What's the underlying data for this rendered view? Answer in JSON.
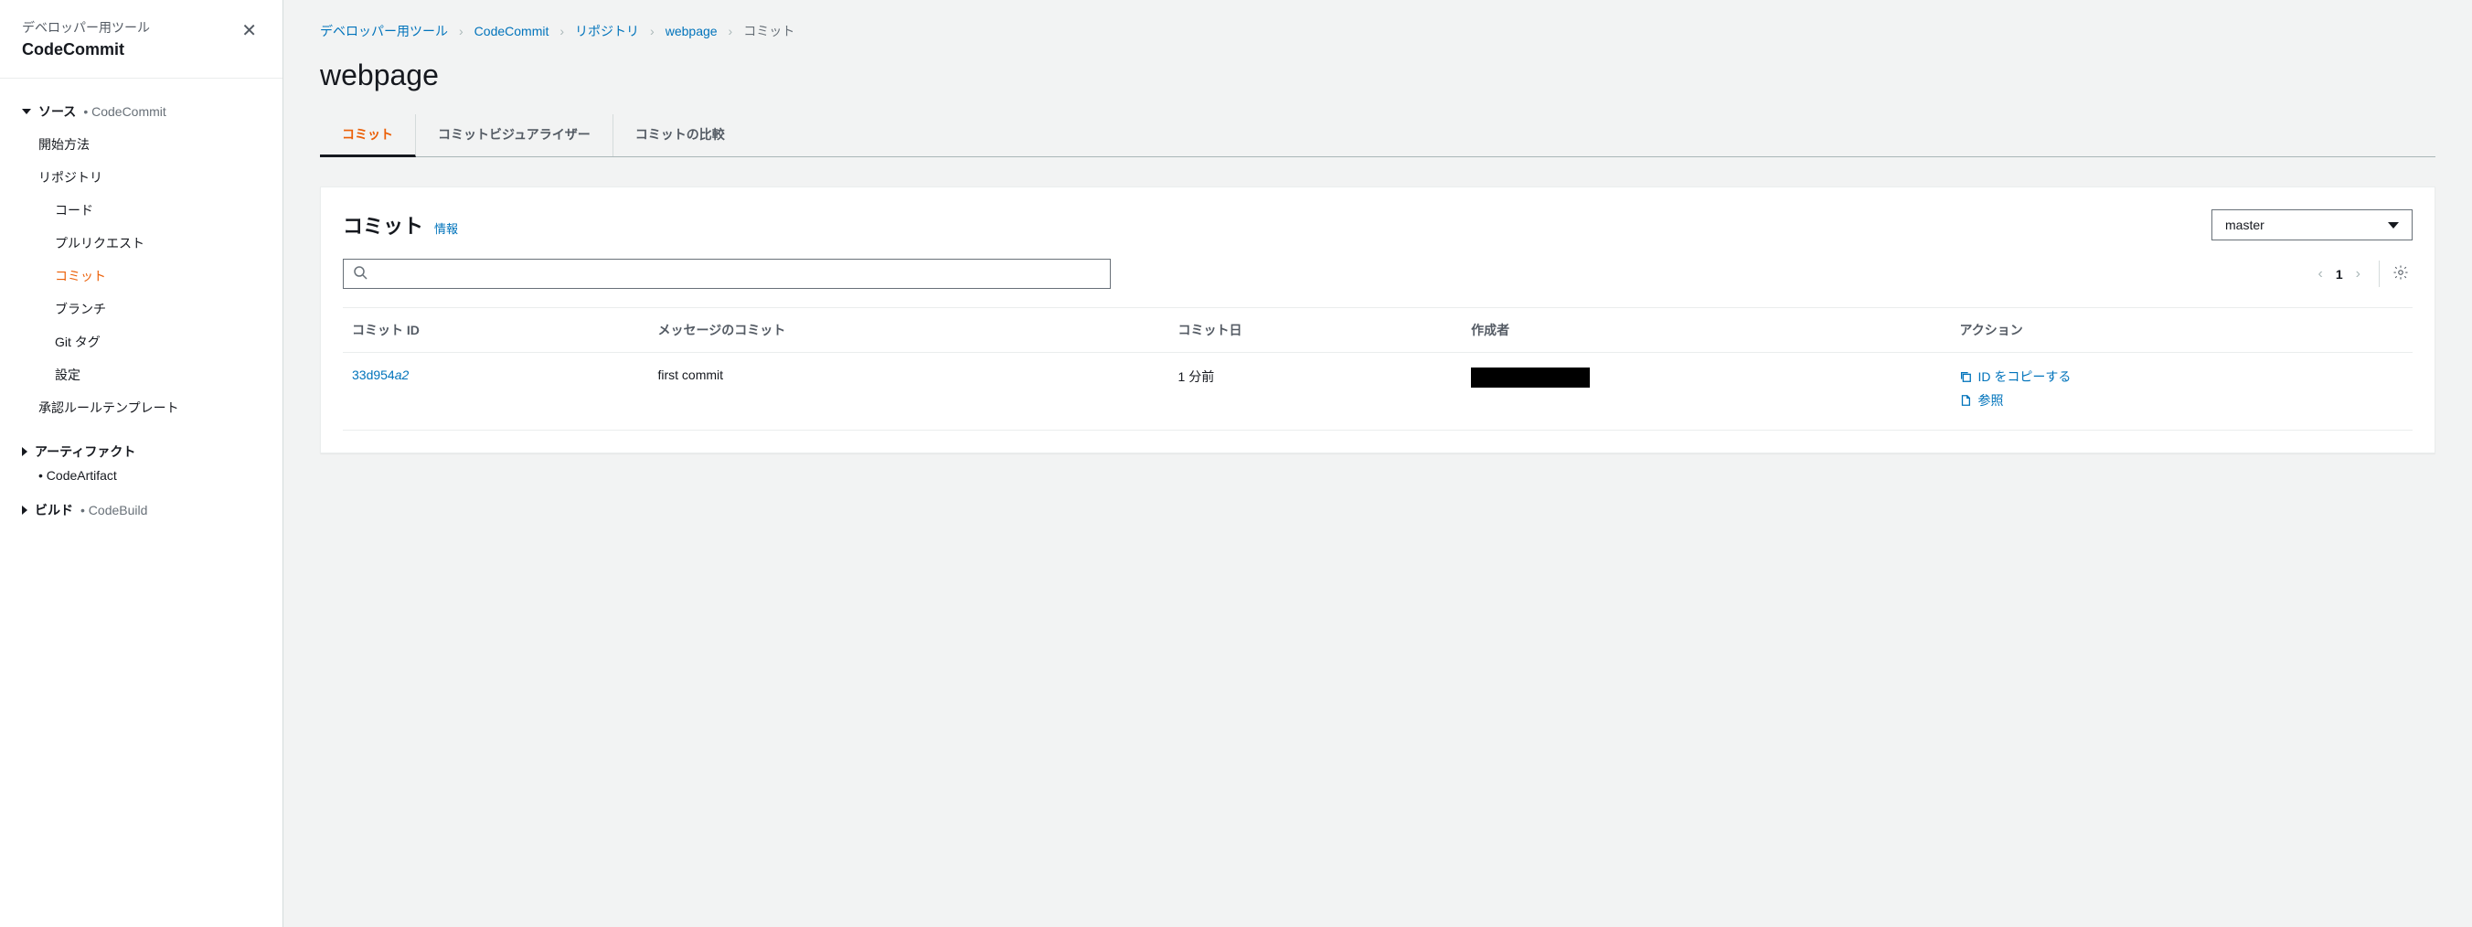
{
  "sidebar": {
    "subtitle": "デベロッパー用ツール",
    "title": "CodeCommit",
    "sections": [
      {
        "label": "ソース",
        "muted": "• CodeCommit",
        "expanded": true,
        "items": [
          {
            "label": "開始方法",
            "indent": false,
            "active": false
          },
          {
            "label": "リポジトリ",
            "indent": false,
            "active": false
          },
          {
            "label": "コード",
            "indent": true,
            "active": false
          },
          {
            "label": "プルリクエスト",
            "indent": true,
            "active": false
          },
          {
            "label": "コミット",
            "indent": true,
            "active": true
          },
          {
            "label": "ブランチ",
            "indent": true,
            "active": false
          },
          {
            "label": "Git タグ",
            "indent": true,
            "active": false
          },
          {
            "label": "設定",
            "indent": true,
            "active": false
          },
          {
            "label": "承認ルールテンプレート",
            "indent": false,
            "active": false
          }
        ]
      },
      {
        "label": "アーティファクト",
        "muted": "• CodeArtifact",
        "expanded": false,
        "muted_below": true
      },
      {
        "label": "ビルド",
        "muted": "• CodeBuild",
        "expanded": false
      }
    ]
  },
  "breadcrumb": [
    {
      "label": "デベロッパー用ツール",
      "link": true
    },
    {
      "label": "CodeCommit",
      "link": true
    },
    {
      "label": "リポジトリ",
      "link": true
    },
    {
      "label": "webpage",
      "link": true
    },
    {
      "label": "コミット",
      "link": false
    }
  ],
  "page_title": "webpage",
  "tabs": [
    {
      "label": "コミット",
      "active": true
    },
    {
      "label": "コミットビジュアライザー",
      "active": false
    },
    {
      "label": "コミットの比較",
      "active": false
    }
  ],
  "panel": {
    "title": "コミット",
    "info": "情報",
    "branch": "master",
    "page_num": "1",
    "columns": [
      "コミット ID",
      "メッセージのコミット",
      "コミット日",
      "作成者",
      "アクション"
    ],
    "rows": [
      {
        "id_norm": "33d954",
        "id_ital": "a2",
        "message": "first commit",
        "date": "1 分前",
        "author": "",
        "actions": {
          "copy": "ID をコピーする",
          "browse": "参照"
        }
      }
    ]
  }
}
